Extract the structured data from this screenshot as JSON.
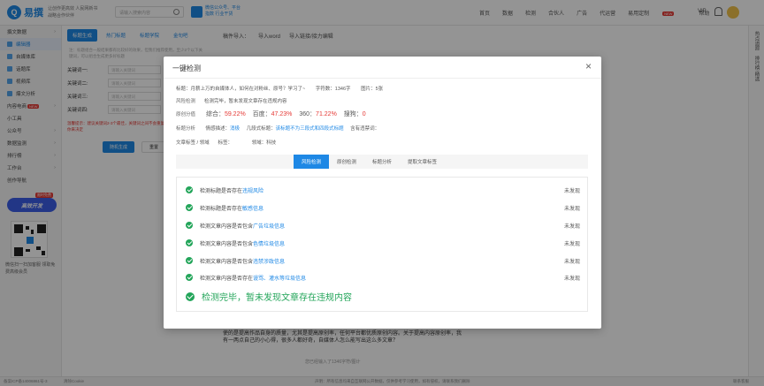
{
  "header": {
    "logo_mark": "Q",
    "logo_text": "易撰",
    "slogan": "让创作更高效 人民网新书战略合作伙伴",
    "search_placeholder": "请输入搜索内容",
    "badge_text": "微信公众号、平台指数 行业干货",
    "nav": [
      "首页",
      "数据",
      "检测",
      "合伙人",
      "广告",
      "代运营",
      "易用定制",
      "帮助"
    ],
    "new_tag": "NEW",
    "vip": "VIP"
  },
  "sidebar": {
    "items": [
      {
        "label": "撰文数据",
        "arrow": "›"
      },
      {
        "label": "编辑器",
        "active": true
      },
      {
        "label": "自媒体库"
      },
      {
        "label": "话题库"
      },
      {
        "label": "视频库"
      },
      {
        "label": "爆文分析"
      },
      {
        "label": "内容电商",
        "badge": "NEW",
        "arrow": "›"
      },
      {
        "label": "小工具"
      },
      {
        "label": "公众号",
        "arrow": "›"
      },
      {
        "label": "数据监测",
        "arrow": "›"
      },
      {
        "label": "排行榜",
        "arrow": "›"
      },
      {
        "label": "工作台",
        "arrow": "›"
      },
      {
        "label": "创作导航"
      }
    ],
    "promo": "高效开发",
    "promo_tag": "限时免费",
    "qr_text": "微信扫一扫加客服 领取免费高级会员"
  },
  "bg_panel": {
    "tabs": [
      "标题生成",
      "热门标题",
      "标题学院",
      "金句吧"
    ],
    "note": "注：标题组合一般结果都有比较好的效果，但我们推荐使用，至少2个以下关键词，可以组合生成更多好标题",
    "keywords": [
      {
        "label": "关键词一:",
        "placeholder": "请输入关键词"
      },
      {
        "label": "关键词二:",
        "placeholder": "请输入关键词"
      },
      {
        "label": "关键词三:",
        "placeholder": "请输入关键词"
      },
      {
        "label": "关键词四:",
        "placeholder": "请输入关键词"
      }
    ],
    "warn": "温馨提示：建议关键词2-3个最佳，关键词之间不会重复 最少2个，优秀标题由你来决定",
    "generate_btn": "随机生成",
    "reset_btn": "重置"
  },
  "editor": {
    "toolbar_label": "稿件导入：",
    "import_word": "导入word",
    "import_link": "导入链接/接力编辑",
    "body_text": "使的是提高作品自身的质量，尤其是提高原创率，任何平台都优质原创内容。关于提高内容原创率，我有一两点自己的小心得，很多人都好奇，自媒体人怎么能写出这么多文章？",
    "count": "您已经输入了1346字符/图计",
    "right_strip": [
      "热点追踪",
      "排行榜·精选"
    ]
  },
  "footer": {
    "left": "备案ICP备14006861号-3",
    "clear": "清除Cookie",
    "center": "声明：所有信息均来自互联网公开数据，仅供参考学习使用，如有侵权，请联系我们删除",
    "right": "联系客服"
  },
  "modal": {
    "title": "一键检测",
    "close": "×",
    "title_line": {
      "label": "标题：",
      "value": "月薪上万的自媒体人，如何在对粉丝、原号？学习了~",
      "chars_label": "字符数：",
      "chars": "1346字",
      "images_label": "图片：",
      "images": "5张"
    },
    "risk": {
      "label": "风险检测",
      "value": "检测完毕，暂未发现文章存在违规内容"
    },
    "originality": {
      "label": "原创分值",
      "items": [
        {
          "name": "综合：",
          "value": "59.22%"
        },
        {
          "name": "百度：",
          "value": "47.23%"
        },
        {
          "name": "360：",
          "value": "71.22%"
        },
        {
          "name": "搜狗：",
          "value": "0"
        }
      ]
    },
    "title_analysis": {
      "label": "标题分析",
      "emotion_label": "情感描述：",
      "emotion": "消极",
      "type_label": "几段式标题：",
      "type": "该标题不为三段式和四段式标题",
      "sensitive_label": "含有违禁词："
    },
    "tags": {
      "label": "文章标签 / 领域",
      "tag_label": "标签：",
      "domain_label": "领域：",
      "domain": "科技"
    },
    "tabs": [
      "风险检测",
      "原创检测",
      "标题分析",
      "提取文章标签"
    ],
    "checks": [
      {
        "prefix": "检测标题是否存在",
        "link": "违规风险",
        "status": "未发现"
      },
      {
        "prefix": "检测标题是否存在",
        "link": "敏感信息",
        "status": "未发现"
      },
      {
        "prefix": "检测文章内容是否包含",
        "link": "广告垃圾信息",
        "status": "未发现"
      },
      {
        "prefix": "检测文章内容是否包含",
        "link": "色情垃圾信息",
        "status": "未发现"
      },
      {
        "prefix": "检测文章内容是否包含",
        "link": "违禁涉政信息",
        "status": "未发现"
      },
      {
        "prefix": "检测文章内容是否存在",
        "link": "谩骂、灌水等垃圾信息",
        "status": "未发现"
      }
    ],
    "final": "检测完毕，暂未发现文章存在违规内容",
    "colors": {
      "accent": "#1e88e5",
      "ok": "#23a55a",
      "score": "#e53935"
    }
  }
}
